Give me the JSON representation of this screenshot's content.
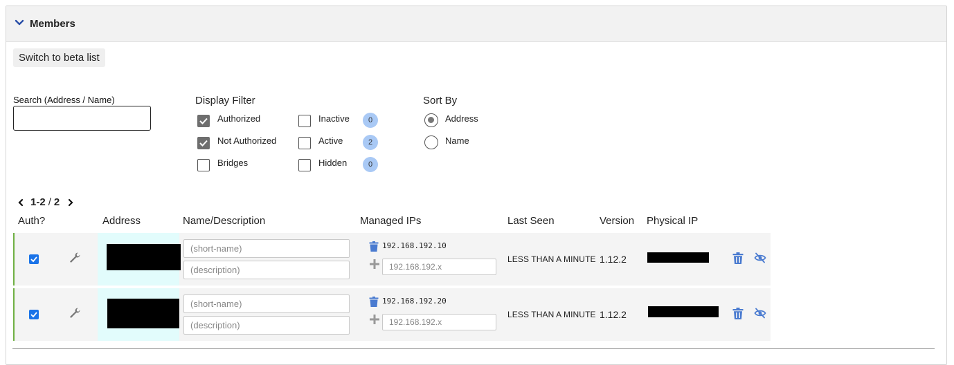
{
  "panel": {
    "title": "Members",
    "beta_button": "Switch to beta list"
  },
  "search": {
    "label": "Search (Address / Name)",
    "value": "",
    "placeholder": ""
  },
  "display_filter": {
    "title": "Display Filter",
    "options": [
      {
        "label": "Authorized",
        "checked": true
      },
      {
        "label": "Not Authorized",
        "checked": true
      },
      {
        "label": "Bridges",
        "checked": false
      },
      {
        "label": "Inactive",
        "checked": false,
        "count": "0"
      },
      {
        "label": "Active",
        "checked": false,
        "count": "2"
      },
      {
        "label": "Hidden",
        "checked": false,
        "count": "0"
      }
    ]
  },
  "sort_by": {
    "title": "Sort By",
    "options": [
      {
        "label": "Address",
        "selected": true
      },
      {
        "label": "Name",
        "selected": false
      }
    ]
  },
  "pager": {
    "range": "1-2",
    "separator": "/",
    "total": "2"
  },
  "table": {
    "headers": {
      "auth": "Auth?",
      "address": "Address",
      "name": "Name/Description",
      "managed_ips": "Managed IPs",
      "last_seen": "Last Seen",
      "version": "Version",
      "physical_ip": "Physical IP"
    },
    "rows": [
      {
        "authorized": true,
        "short_name_placeholder": "(short-name)",
        "description_placeholder": "(description)",
        "managed_ip": "192.168.192.10",
        "ip_placeholder": "192.168.192.x",
        "last_seen": "LESS THAN A MINUTE",
        "version": "1.12.2"
      },
      {
        "authorized": true,
        "short_name_placeholder": "(short-name)",
        "description_placeholder": "(description)",
        "managed_ip": "192.168.192.20",
        "ip_placeholder": "192.168.192.x",
        "last_seen": "LESS THAN A MINUTE",
        "version": "1.12.2"
      }
    ]
  },
  "colors": {
    "accent_blue": "#1a73e8",
    "icon_blue": "#4a7bd0",
    "badge_blue": "#a9c9f5",
    "address_cell_bg": "#e2fcfc",
    "row_bg": "#f4f4f4",
    "authorized_border": "#6fb043"
  },
  "icons": [
    "chevron-down-icon",
    "chevron-left-icon",
    "chevron-right-icon",
    "wrench-icon",
    "trash-icon",
    "plus-icon",
    "eye-off-icon",
    "checkmark-icon"
  ]
}
